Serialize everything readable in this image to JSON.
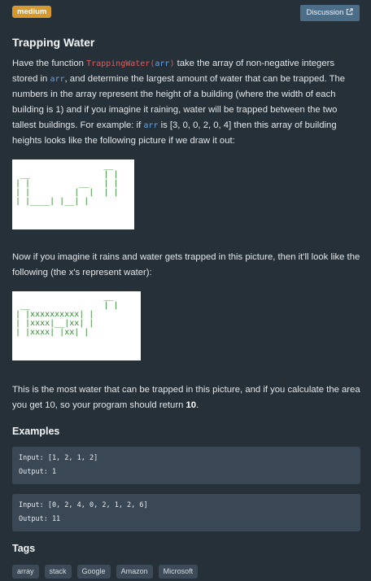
{
  "header": {
    "difficulty": "medium",
    "discussion_label": "Discussion"
  },
  "problem": {
    "title": "Trapping Water",
    "intro_1": "Have the function ",
    "fn_name": "TrappingWater",
    "fn_paren_open": "(",
    "fn_arg": "arr",
    "fn_paren_close": ")",
    "intro_2": " take the array of non-negative integers stored in ",
    "arr_ref": "arr",
    "intro_3": ", and determine the largest amount of water that can be trapped. The numbers in the array represent the height of a building (where the width of each building is 1) and if you imagine it raining, water will be trapped between the two tallest buildings. For example: if ",
    "arr_ref_2": "arr",
    "intro_4": " is [3, 0, 0, 2, 0, 4] then this array of building heights looks like the following picture if we draw it out:",
    "figure_1": "                  __\n __               | |\n| |          __   | |\n| |         |  |  | |\n| |____| |__| |\n",
    "figure_2": "                  __\n __               | |\n| |xxxxxxxxxx| |\n| |xxxx|__|xx| |\n| |xxxx| |xx| |\n",
    "rain_text": "Now if you imagine it rains and water gets trapped in this picture, then it'll look like the following (the x's represent water):",
    "result_text": "This is the most water that can be trapped in this picture, and if you calculate the area you get 10, so your program should return ",
    "result_value": "10",
    "result_end": "."
  },
  "examples": {
    "heading": "Examples",
    "items": [
      {
        "input": "Input: [1, 2, 1, 2]",
        "output": "Output: 1"
      },
      {
        "input": "Input: [0, 2, 4, 0, 2, 1, 2, 6]",
        "output": "Output: 11"
      }
    ]
  },
  "tags": {
    "heading": "Tags",
    "items": [
      "array",
      "stack",
      "Google",
      "Amazon",
      "Microsoft"
    ]
  },
  "colors": {
    "background": "#263038",
    "badge": "#d7982d",
    "button": "#4c6d88",
    "code_red": "#e05b5b",
    "code_blue": "#6aa2e0",
    "figure_green": "#2e8c2e"
  }
}
